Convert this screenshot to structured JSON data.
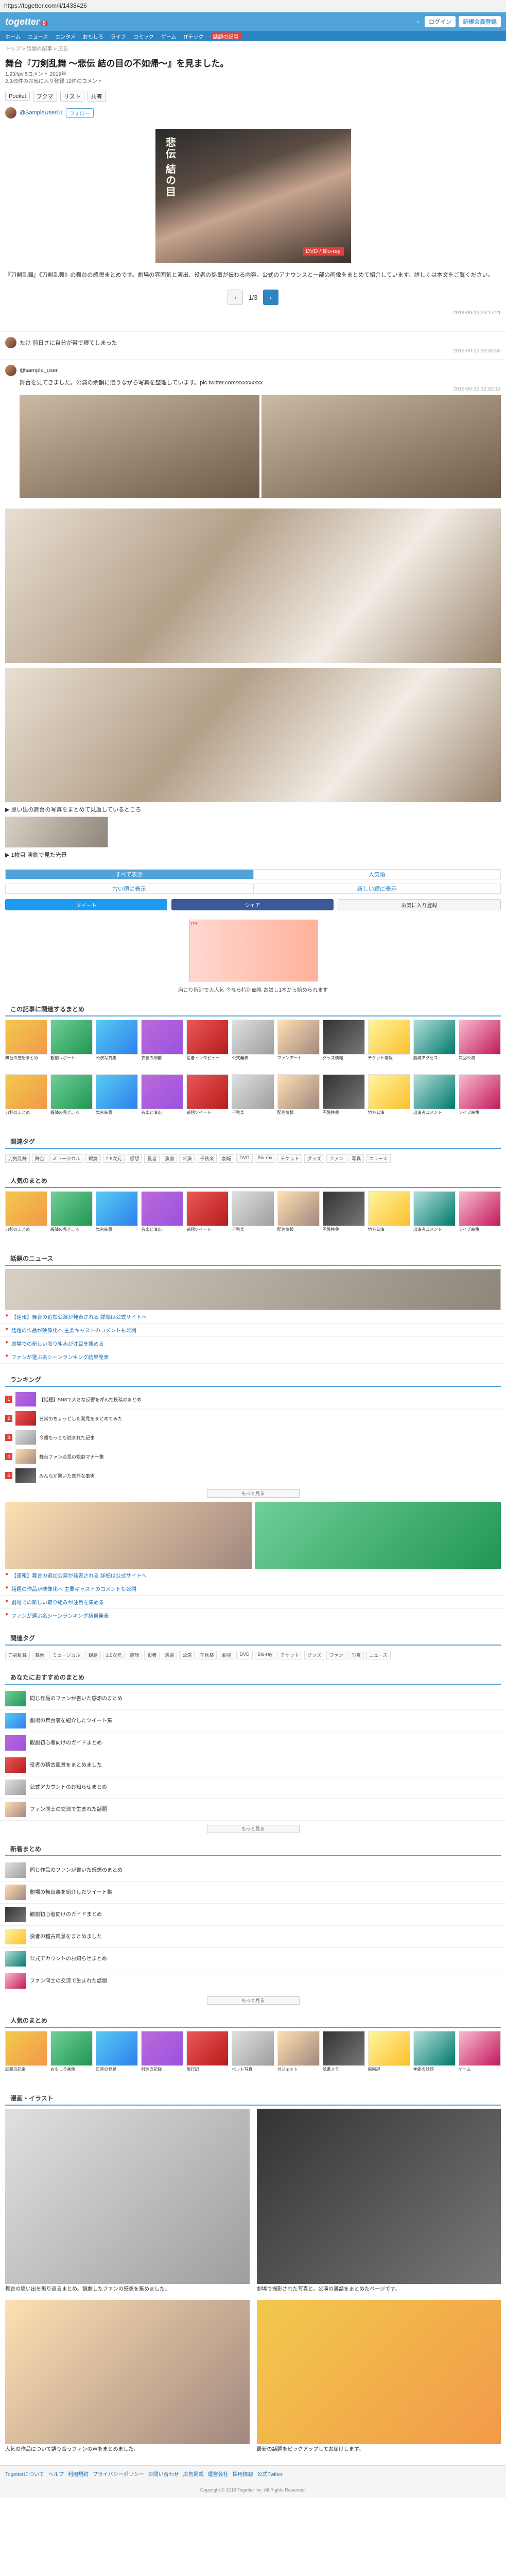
{
  "browser": {
    "url": "https://togetter.com/li/1438426"
  },
  "header": {
    "logo": "togetter",
    "badge": "β",
    "login_label": "ログイン",
    "signup_label": "新規会員登録",
    "nav": [
      "ホーム",
      "ニュース",
      "エンタメ",
      "おもしろ",
      "ライフ",
      "コミック",
      "ゲーム",
      "ITテック",
      "話題の記事"
    ]
  },
  "article": {
    "breadcrumb": "トップ > 話題の記事 > 広告",
    "title": "舞台『刀剣乱舞 〜悲伝 結の目の不如帰〜』を見ました。",
    "meta_lines": [
      "1,234pv 5コメント 2019年",
      "2,345件のお気に入り登録 12件のコメント"
    ],
    "actions": [
      "Pocket",
      "ブクマ",
      "リスト",
      "共有"
    ],
    "user": {
      "name": "@SampleUser01",
      "follow": "フォロー"
    },
    "hero_text": "悲伝 結の目",
    "hero_tag": "DVD / Blu-ray",
    "caption": "『刀剣乱舞』《刀剣乱舞》の舞台の感想まとめです。劇場の雰囲気と演出、役者の熱量が伝わる内容。公式のアナウンスと一部の画像をまとめて紹介しています。詳しくは本文をご覧ください。",
    "pager": {
      "prev": "‹",
      "label": "1/3",
      "next": "›"
    },
    "footnote": "2019-09-12 23:17:21"
  },
  "tweets": [
    {
      "handle": "たけ 前日さに自分が帯で寝てしまった",
      "text": "",
      "date": "2019-09-12 18:35:55"
    },
    {
      "handle": "@sample_user",
      "text": "舞台を見てきました。公演の余韻に浸りながら写真を整理しています。pic.twitter.com/xxxxxxxxx",
      "date": "2019-09-12 19:02:13"
    }
  ],
  "tweet_links": [
    "▶ 思い出の舞台の写真をまとめて見返しているところ",
    "▶ 1枚目 演劇で見た光景"
  ],
  "tabs": [
    "すべて表示",
    "人気順",
    "古い順に表示",
    "新しい順に表示"
  ],
  "share": {
    "twitter": "ツイート",
    "facebook": "シェア",
    "hatena": "お気に入り登録"
  },
  "ad": {
    "label": "PR",
    "caption": "肩こり解消で大人気 今なら特別価格 お試し1本から始められます"
  },
  "sections": {
    "related_title": "この記事に関連するまとめ",
    "popular_title": "人気のまとめ",
    "tags_title": "関連タグ",
    "news_title": "話題のニュース",
    "ranking_title": "ランキング",
    "recommend_title": "あなたにおすすめのまとめ",
    "more_label": "もっと見る",
    "new_title": "新着まとめ",
    "manga_title": "漫画・イラスト"
  },
  "grid_captions": [
    "舞台の感想まとめ",
    "観劇レポート",
    "公演写真集",
    "衣装の細部",
    "役者インタビュー",
    "公式発表",
    "ファンアート",
    "グッズ情報",
    "チケット情報",
    "劇場アクセス",
    "次回公演",
    "刀剣のまとめ",
    "殺陣の見どころ",
    "舞台装置",
    "音楽と演出",
    "感想ツイート",
    "千秋楽",
    "配信情報",
    "円盤特典",
    "地方公演",
    "出演者コメント",
    "ライブ映像",
    "話題の記事",
    "おもしろ画像",
    "日常の発見",
    "料理の記録",
    "旅行記",
    "ペット写真",
    "ガジェット",
    "読書メモ",
    "映画評",
    "季節の話題",
    "ゲーム"
  ],
  "tags": [
    "刀剣乱舞",
    "舞台",
    "ミュージカル",
    "観劇",
    "2.5次元",
    "感想",
    "役者",
    "演劇",
    "公演",
    "千秋楽",
    "劇場",
    "DVD",
    "Blu-ray",
    "チケット",
    "グッズ",
    "ファン",
    "写真",
    "ニュース"
  ],
  "news": [
    "【速報】舞台の追加公演が発表される 詳細は公式サイトへ",
    "話題の作品が映像化へ 主要キャストのコメントも公開",
    "劇場での新しい取り組みが注目を集める",
    "ファンが選ぶ名シーンランキング結果発表"
  ],
  "ranking": [
    "【話題】SNSで大きな反響を呼んだ投稿のまとめ",
    "日常のちょっとした発見をまとめてみた",
    "今週もっとも読まれた記事",
    "舞台ファン必見の観劇マナー集",
    "みんなが驚いた意外な事実"
  ],
  "recommend": [
    "同じ作品のファンが書いた感想のまとめ",
    "劇場の舞台裏を紹介したツイート集",
    "観劇初心者向けのガイドまとめ",
    "役者の稽古風景をまとめました",
    "公式アカウントのお知らせまとめ",
    "ファン同士の交流で生まれた話題"
  ],
  "cards": [
    "舞台の思い出を振り返るまとめ。観劇したファンの感想を集めました。",
    "劇場で撮影された写真と、公演の裏話をまとめたページです。",
    "人気の作品について語り合うファンの声をまとめました。",
    "最新の話題をピックアップしてお届けします。"
  ],
  "footer": {
    "links": [
      "Togetterについて",
      "ヘルプ",
      "利用規約",
      "プライバシーポリシー",
      "お問い合わせ",
      "広告掲載",
      "運営会社",
      "採用情報",
      "公式Twitter"
    ],
    "copyright": "Copyright © 2019 Togetter Inc. All Rights Reserved."
  }
}
